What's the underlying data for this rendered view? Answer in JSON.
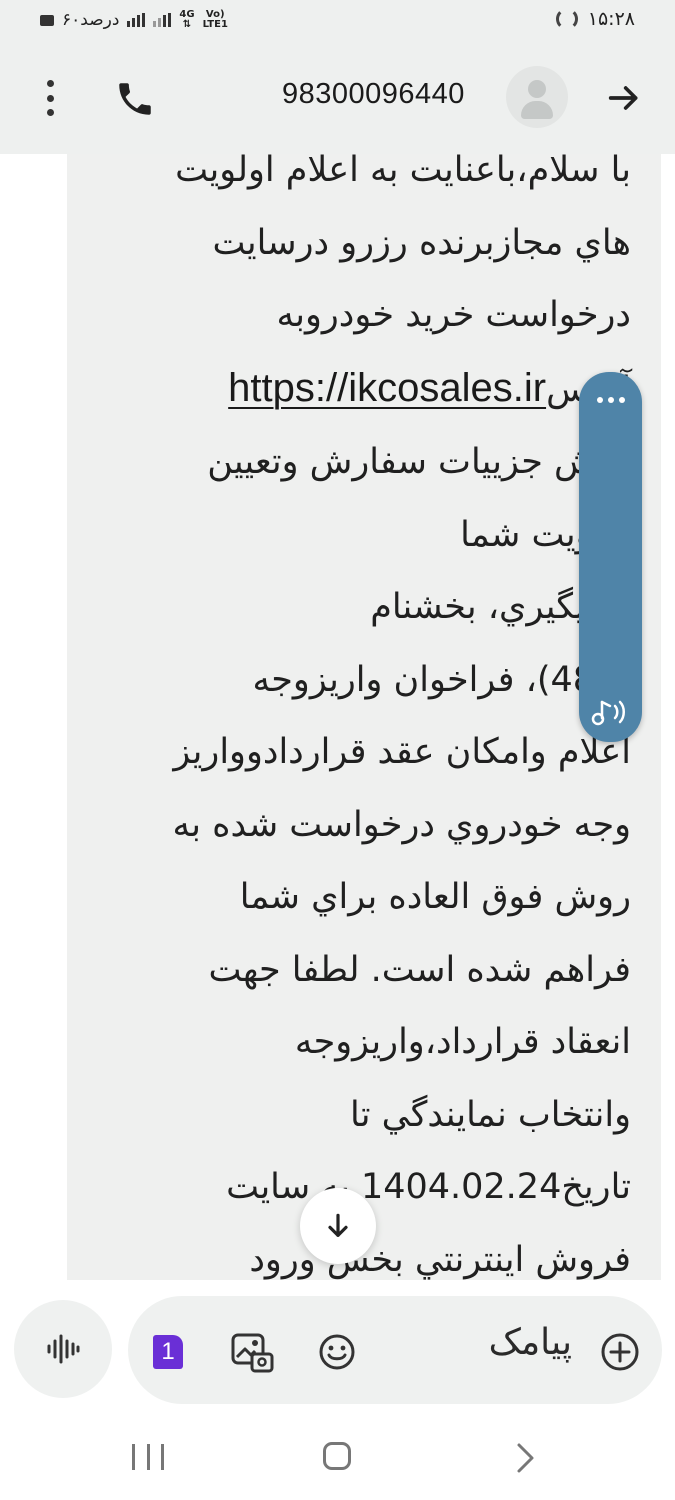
{
  "status_bar": {
    "battery_text": "۶۰درصد",
    "network_type": "4G",
    "volte": "Vo)",
    "lte": "LTE1",
    "time": "۱۵:۲۸"
  },
  "app_bar": {
    "contact_number": "98300096440"
  },
  "message": {
    "text_before_link": "با سلام،باعنایت به اعلام اولویت\nهاي مجازبرنده رزرو درسایت\nدرخواست خرید خودروبه\nآدرس",
    "link": "https://ikcosales.ir",
    "text_after_link": "\nبخش جزییات سفارش وتعیین\nاولویت شما\nکدپیگیري،                 بخشنام\n(487)، فراخوان واریزوجه\nاعلام وامکان عقد قراردادوواریز\nوجه خودروي درخواست شده به\nروش فوق العاده براي شما\nفراهم شده است. لطفا جهت\nانعقاد قرارداد،واریزوجه\nوانتخاب نمایندگي تا\nتاریخ1404.02.24 به سایت\nفروش اینترنتي بخش ورود"
  },
  "compose": {
    "sim_number": "1",
    "placeholder": "پیامک"
  },
  "colors": {
    "header_bg": "#eef0ef",
    "bubble_bg": "#eff0ef",
    "float_panel": "#4f84a8",
    "sim_badge": "#6a2fd6"
  }
}
